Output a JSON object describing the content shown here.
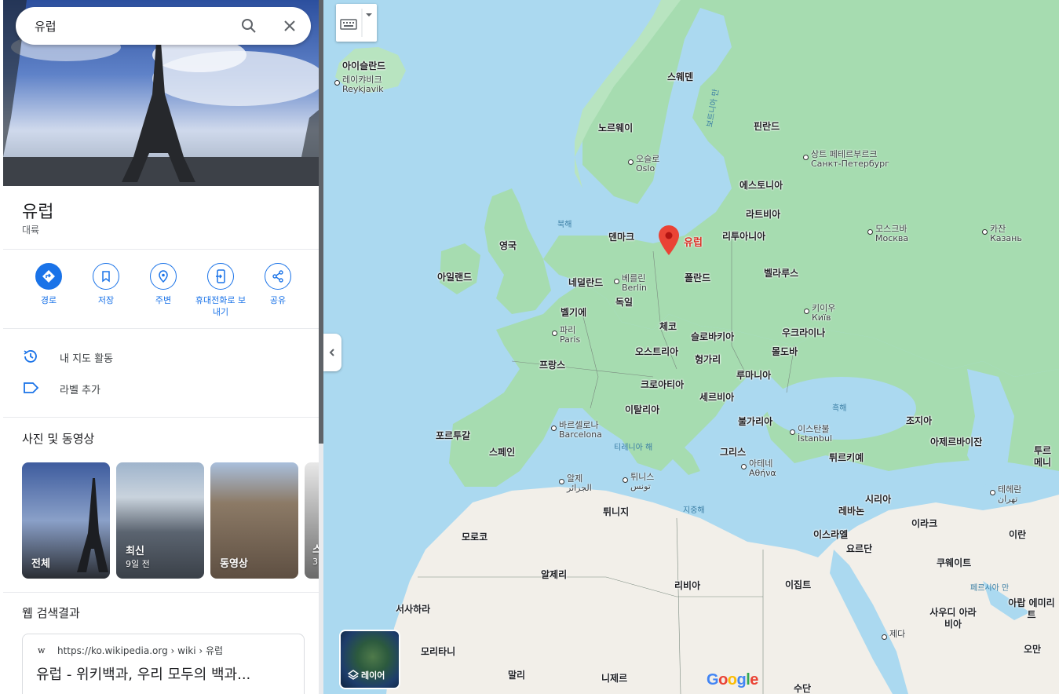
{
  "search": {
    "query": "유럽"
  },
  "place": {
    "title": "유럽",
    "category": "대륙"
  },
  "actions": [
    {
      "label": "경로",
      "icon": "directions-icon"
    },
    {
      "label": "저장",
      "icon": "bookmark-icon"
    },
    {
      "label": "주변",
      "icon": "nearby-icon"
    },
    {
      "label": "휴대전화로 보내기",
      "icon": "send-to-phone-icon"
    },
    {
      "label": "공유",
      "icon": "share-icon"
    }
  ],
  "list_items": [
    {
      "label": "내 지도 활동",
      "icon": "history-icon"
    },
    {
      "label": "라벨 추가",
      "icon": "label-icon"
    }
  ],
  "photos_section": {
    "title": "사진 및 동영상",
    "tiles": [
      {
        "label": "전체",
        "sub": ""
      },
      {
        "label": "최신",
        "sub": "9일 전"
      },
      {
        "label": "동영상",
        "sub": ""
      },
      {
        "label": "스",
        "sub": "3"
      }
    ]
  },
  "web_section": {
    "title": "웹 검색결과",
    "result_url": "https://ko.wikipedia.org › wiki › 유럽",
    "result_title": "유럽 - 위키백과, 우리 모두의 백과..."
  },
  "map": {
    "pin_label": "유럽",
    "layers_label": "레이어",
    "attribution": "Google",
    "countries": [
      "아이슬란드",
      "스웨덴",
      "노르웨이",
      "핀란드",
      "에스토니아",
      "라트비아",
      "덴마크",
      "리투아니아",
      "영국",
      "아일랜드",
      "네덜란드",
      "폴란드",
      "벨라루스",
      "독일",
      "벨기에",
      "체코",
      "슬로바키아",
      "우크라이나",
      "프랑스",
      "오스트리아",
      "헝가리",
      "몰도바",
      "루마니아",
      "크로아티아",
      "세르비아",
      "이탈리아",
      "불가리아",
      "포르투갈",
      "스페인",
      "그리스",
      "튀르키예",
      "조지아",
      "아제르바이잔",
      "시리아",
      "레바논",
      "이라크",
      "이란",
      "모로코",
      "튀니지",
      "이스라엘",
      "요르단",
      "알제리",
      "리비아",
      "이집트",
      "쿠웨이트",
      "서사하라",
      "사우디 아라비아",
      "아랍 에미리트",
      "모리타니",
      "말리",
      "니제르",
      "수단",
      "오만",
      "투르 메니"
    ],
    "cities": [
      "레이캬비크",
      "Reykjavik",
      "오슬로",
      "Oslo",
      "상트 페테르부르크",
      "Санкт-Петербург",
      "모스크바",
      "Москва",
      "카잔",
      "Казань",
      "베를린",
      "Berlin",
      "파리",
      "Paris",
      "키이우",
      "Київ",
      "바르셀로나",
      "Barcelona",
      "이스탄불",
      "İstanbul",
      "아테네",
      "Αθήνα",
      "알제",
      "الجزائر",
      "튀니스",
      "تونس",
      "테헤란",
      "تهران",
      "제다"
    ],
    "seas": [
      "북해",
      "보트니아 만",
      "흑해",
      "티레니아 해",
      "지중해",
      "페르시아 만"
    ]
  }
}
